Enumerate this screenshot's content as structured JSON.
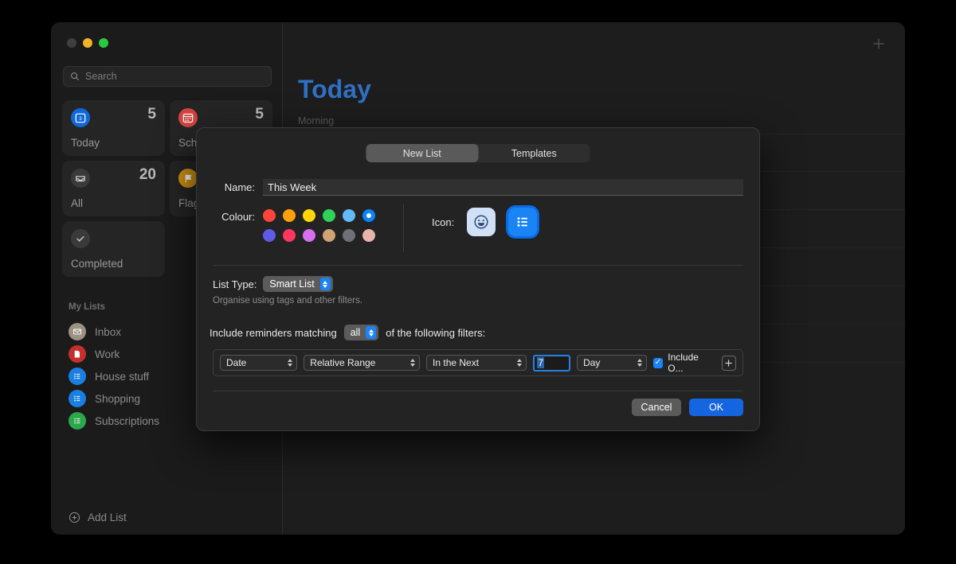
{
  "window": {
    "traffic_lights": [
      "close",
      "minimize",
      "maximize"
    ],
    "search": {
      "placeholder": "Search",
      "icon": "search-icon"
    }
  },
  "sidebar": {
    "cards": [
      {
        "name": "Today",
        "count": "5",
        "icon": "calendar-day-icon",
        "color": "#1068d8"
      },
      {
        "name": "Sch",
        "count": "5",
        "icon": "calendar-icon",
        "color": "#d2453f"
      },
      {
        "name": "All",
        "count": "20",
        "icon": "inbox-tray-icon",
        "color": "#3a3a3a"
      },
      {
        "name": "Flag",
        "count": "",
        "icon": "flag-icon",
        "color": "#d09214"
      },
      {
        "name": "Completed",
        "count": "",
        "icon": "check-circle-icon",
        "color": "#3a3a3a"
      }
    ],
    "section_header": "My Lists",
    "lists": [
      {
        "label": "Inbox",
        "icon": "envelope-icon",
        "color": "#9d9183"
      },
      {
        "label": "Work",
        "icon": "document-icon",
        "color": "#c5302c"
      },
      {
        "label": "House stuff",
        "icon": "list-icon",
        "color": "#1a7fe0"
      },
      {
        "label": "Shopping",
        "icon": "list-icon",
        "color": "#1a7fe0"
      },
      {
        "label": "Subscriptions",
        "icon": "list-icon",
        "color": "#2aa84a"
      }
    ],
    "add_list": {
      "label": "Add List",
      "icon": "plus-circle-icon"
    }
  },
  "main": {
    "title": "Today",
    "title_color": "#2f6fc4",
    "section_label": "Morning",
    "add_button_icon": "plus-icon",
    "row_count": 6
  },
  "dialog": {
    "tabs": [
      {
        "label": "New List",
        "selected": true
      },
      {
        "label": "Templates",
        "selected": false
      }
    ],
    "name": {
      "label": "Name:",
      "value": "This Week"
    },
    "colour": {
      "label": "Colour:",
      "swatches": [
        "#ff453a",
        "#ff9f0a",
        "#ffd60a",
        "#30d158",
        "#64b9f7",
        "#0a84ff",
        "#5e5ce6",
        "#ff375f",
        "#d86ef0",
        "#cfa373",
        "#6e7278",
        "#e8b3a8"
      ],
      "selected_index": 5
    },
    "icon": {
      "label": "Icon:",
      "options": [
        {
          "name": "smiley-icon",
          "selected": false
        },
        {
          "name": "list-icon",
          "selected": true
        }
      ]
    },
    "list_type": {
      "label": "List Type:",
      "value": "Smart List",
      "helper": "Organise using tags and other filters."
    },
    "match": {
      "prefix": "Include reminders matching",
      "value": "all",
      "suffix": "of the following filters:"
    },
    "filter_row": {
      "field": "Date",
      "operator": "Relative Range",
      "relation": "In the Next",
      "amount": "7",
      "unit": "Day",
      "checkbox": {
        "label": "Include O...",
        "checked": true
      },
      "add_icon": "plus-icon"
    },
    "buttons": {
      "cancel": "Cancel",
      "ok": "OK"
    }
  }
}
